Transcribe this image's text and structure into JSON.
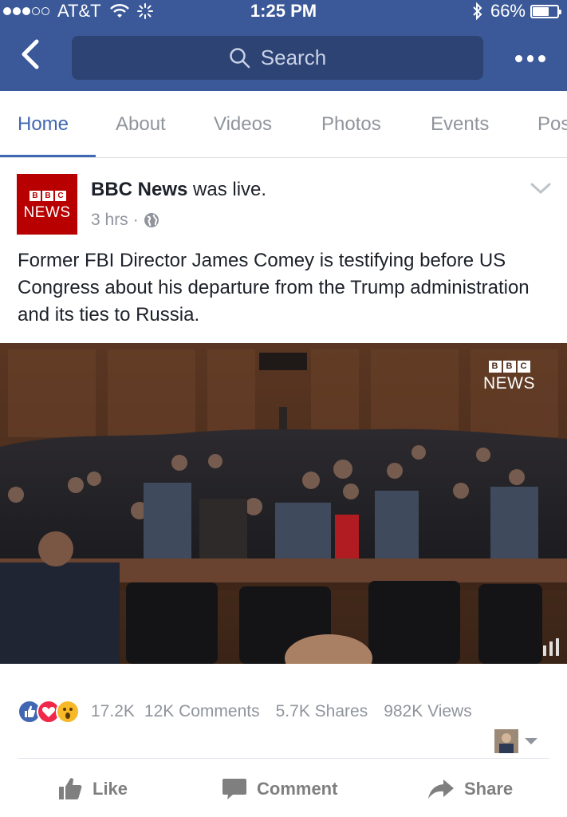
{
  "status_bar": {
    "carrier": "AT&T",
    "time": "1:25 PM",
    "battery": "66%",
    "battery_level": 0.66
  },
  "header": {
    "search_placeholder": "Search"
  },
  "tabs": [
    {
      "label": "Home",
      "active": true
    },
    {
      "label": "About",
      "active": false
    },
    {
      "label": "Videos",
      "active": false
    },
    {
      "label": "Photos",
      "active": false
    },
    {
      "label": "Events",
      "active": false
    },
    {
      "label": "Pos",
      "active": false
    }
  ],
  "post": {
    "avatar": {
      "logo_text": "BBC",
      "logo_sub": "NEWS"
    },
    "author": "BBC News",
    "author_suffix": "was live.",
    "time": "3 hrs",
    "text": "Former FBI Director James Comey is testifying before US Congress about his departure from the Trump administration and its ties to Russia.",
    "video_logo": {
      "top": "BBC",
      "bottom": "NEWS"
    }
  },
  "engagement": {
    "reaction_count": "17.2K",
    "comments": "12K Comments",
    "shares": "5.7K Shares",
    "views": "982K Views"
  },
  "actions": {
    "like": "Like",
    "comment": "Comment",
    "share": "Share"
  },
  "colors": {
    "brand_blue": "#3b5998",
    "active_tab": "#4267b2",
    "bbc_red": "#b80000"
  }
}
